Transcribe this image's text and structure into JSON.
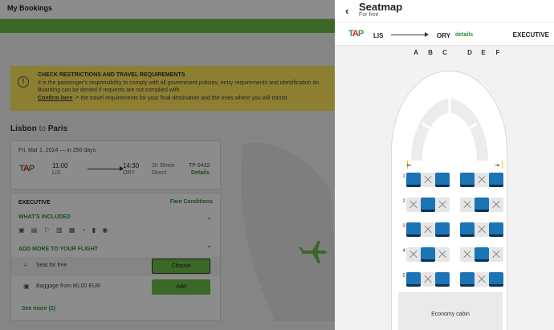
{
  "background": {
    "topbar_title": "My Bookings",
    "alert": {
      "icon": "info-icon",
      "title": "CHECK RESTRICTIONS AND TRAVEL REQUIREMENTS",
      "line1": "It is the passenger's responsibility to comply with all government policies, entry requirements and identification do",
      "line2": "Boarding can be denied if requests are not complied with.",
      "link": "Confirm here",
      "line3": "the travel requirements for your final destination and the ones where you will transit."
    },
    "route": {
      "from": "Lisbon",
      "to_word": "to",
      "to": "Paris"
    },
    "flight": {
      "date": "Fri, Mar 1, 2024 — in 250 days",
      "dep_time": "11:00",
      "dep_code": "LIS",
      "arr_time": "14:30",
      "arr_code": "ORY",
      "duration": "2h 30min",
      "stops": "Direct",
      "number": "TP 0432",
      "details": "Details"
    },
    "fare": {
      "name": "EXECUTIVE",
      "conditions": "Fare Conditions",
      "included_heading": "WHAT'S INCLUDED",
      "included_icons": "▣ ▤ ⚐ ▥ ▦ ◔ ▮ ◉",
      "addons_heading": "ADD MORE TO YOUR FLIGHT",
      "addons": [
        {
          "label": "Seat for free",
          "button": "Choose"
        },
        {
          "label": "Baggage from 80,00 EUR",
          "button": "Add"
        }
      ],
      "see_more": "See more (2)"
    }
  },
  "panel": {
    "title": "Seatmap",
    "subtitle": "For free",
    "airline_logo": "TAP",
    "from": "LIS",
    "to": "ORY",
    "details_link": "details",
    "cabin_class": "EXECUTIVE",
    "columns": [
      "A",
      "B",
      "C",
      "D",
      "E",
      "F"
    ],
    "exit_left": "⇤",
    "exit_right": "⇥",
    "rows": [
      {
        "num": "1",
        "red": true,
        "seats": [
          "free",
          "taken",
          "free",
          "free",
          "taken",
          "free"
        ]
      },
      {
        "num": "2",
        "red": false,
        "seats": [
          "taken",
          "free",
          "taken",
          "taken",
          "free",
          "taken"
        ]
      },
      {
        "num": "3",
        "red": true,
        "seats": [
          "free",
          "taken",
          "free",
          "free",
          "taken",
          "free"
        ]
      },
      {
        "num": "4",
        "red": false,
        "seats": [
          "taken",
          "free",
          "taken",
          "taken",
          "free",
          "taken"
        ]
      },
      {
        "num": "5",
        "red": false,
        "seats": [
          "free",
          "taken",
          "free",
          "free",
          "taken",
          "free"
        ]
      }
    ],
    "economy_label": "Economy cabin"
  },
  "colors": {
    "brand_green": "#6cbe45",
    "link_green": "#2e8f3f",
    "seat_free": "#1b74b5",
    "seat_taken": "#e6e6e6",
    "alert_yellow": "#ffe85c"
  }
}
